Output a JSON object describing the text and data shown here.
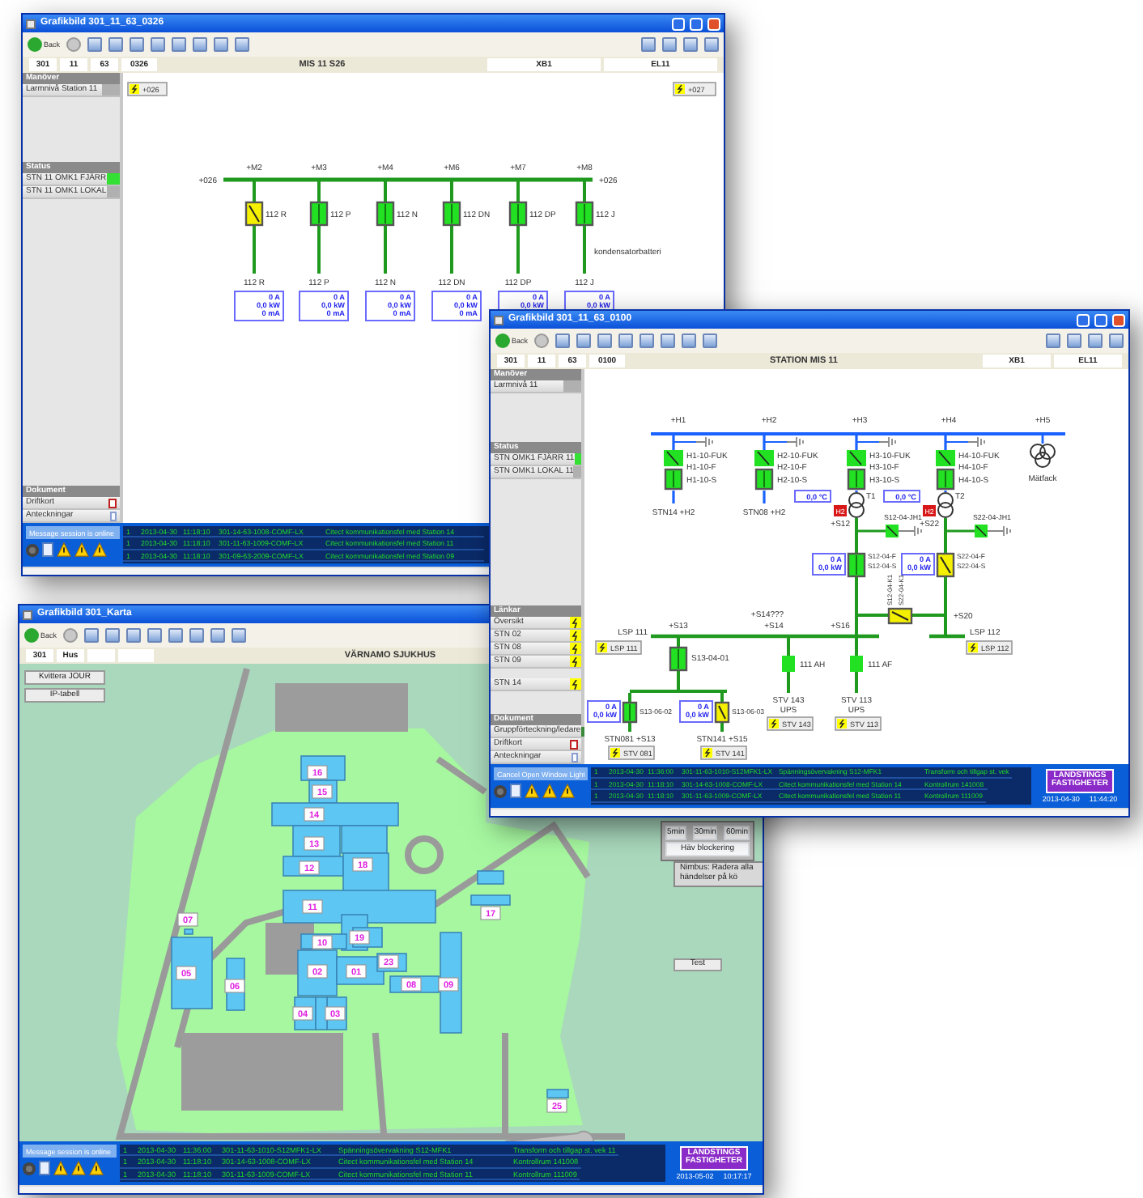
{
  "windows": [
    {
      "title": "Grafikbild 301_11_63_0326",
      "back_label": "Back",
      "address": [
        "301",
        "11",
        "63",
        "0326"
      ],
      "heading": "MIS 11 S26",
      "right_fields": [
        "XB1",
        "EL11"
      ],
      "sidebar": [
        {
          "title": "Manöver",
          "items": [
            {
              "label": "Larmnivå Station 11",
              "kind": "indicator",
              "on": false
            }
          ]
        },
        {
          "title": "Status",
          "items": [
            {
              "label": "STN 11 OMK1 FJÄRR",
              "kind": "indicator",
              "on": true
            },
            {
              "label": "STN 11 OMK1 LOKAL",
              "kind": "indicator",
              "on": false
            }
          ]
        },
        {
          "title": "Dokument",
          "items": [
            {
              "label": "Driftkort",
              "kind": "document"
            },
            {
              "label": "Anteckningar",
              "kind": "note"
            }
          ]
        }
      ],
      "diagram": {
        "kind": "feeders",
        "links": [
          "+026",
          "+027"
        ],
        "bus_ends": [
          "+026",
          "+026"
        ],
        "note": "kondensatorbatteri",
        "feeders": [
          {
            "bus_label": "+M2",
            "breaker": "112 R",
            "open": true,
            "end": "112 R",
            "readings": [
              "0 A",
              "0,0 kW",
              "0 mA"
            ]
          },
          {
            "bus_label": "+M3",
            "breaker": "112 P",
            "open": false,
            "end": "112 P",
            "readings": [
              "0 A",
              "0,0 kW",
              "0 mA"
            ]
          },
          {
            "bus_label": "+M4",
            "breaker": "112 N",
            "open": false,
            "end": "112 N",
            "readings": [
              "0 A",
              "0,0 kW",
              "0 mA"
            ]
          },
          {
            "bus_label": "+M6",
            "breaker": "112 DN",
            "open": false,
            "end": "112 DN",
            "readings": [
              "0 A",
              "0,0 kW",
              "0 mA"
            ]
          },
          {
            "bus_label": "+M7",
            "breaker": "112 DP",
            "open": false,
            "end": "112 DP",
            "readings": [
              "0 A",
              "0,0 kW"
            ]
          },
          {
            "bus_label": "+M8",
            "breaker": "112 J",
            "open": false,
            "end": "112 J",
            "readings": [
              "0 A",
              "0,0 kW"
            ]
          }
        ]
      },
      "alarms": {
        "message": "Message session is online",
        "rows": [
          {
            "n": "1",
            "date": "2013-04-30",
            "time": "11:18:10",
            "tag": "301-14-63-1008-COMF-LX",
            "text": "Citect kommunikationsfel med Station 14"
          },
          {
            "n": "1",
            "date": "2013-04-30",
            "time": "11:18:10",
            "tag": "301-11-63-1009-COMF-LX",
            "text": "Citect kommunikationsfel med Station 11"
          },
          {
            "n": "1",
            "date": "2013-04-30",
            "time": "11:18:10",
            "tag": "301-09-63-2009-COMF-LX",
            "text": "Citect kommunikationsfel med Station 09"
          }
        ]
      }
    },
    {
      "title": "Grafikbild 301_Karta",
      "back_label": "Back",
      "address": [
        "301",
        "Hus"
      ],
      "heading": "VÄRNAMO SJUKHUS",
      "diagram": {
        "kind": "map",
        "buttons": [
          "Kvittera JOUR",
          "IP-tabell"
        ],
        "buildings": [
          "16",
          "15",
          "14",
          "13",
          "12",
          "18",
          "11",
          "10",
          "19",
          "02",
          "01",
          "23",
          "08",
          "09",
          "04",
          "03",
          "05",
          "06",
          "07",
          "17",
          "25"
        ],
        "time_buttons": [
          "5min",
          "30min",
          "60min"
        ],
        "unblock": "Häv blockering",
        "note": "Nimbus: Radera alla händelser på kö",
        "test": "Test"
      },
      "alarms": {
        "message": "Message session is online",
        "rows": [
          {
            "n": "1",
            "date": "2013-04-30",
            "time": "11:36:00",
            "tag": "301-11-63-1010-S12MFK1-LX",
            "text": "Spänningsövervakning S12-MFK1",
            "location": "Transform och tillgap st. vek 11"
          },
          {
            "n": "1",
            "date": "2013-04-30",
            "time": "11:18:10",
            "tag": "301-14-63-1008-COMF-LX",
            "text": "Citect kommunikationsfel med Station 14",
            "location": "Kontrollrum 141008"
          },
          {
            "n": "1",
            "date": "2013-04-30",
            "time": "11:18:10",
            "tag": "301-11-63-1009-COMF-LX",
            "text": "Citect kommunikationsfel med Station 11",
            "location": "Kontrollrum 111009"
          }
        ]
      },
      "logo": [
        "LANDSTINGS",
        "FASTIGHETER"
      ],
      "clock": [
        "2013-05-02",
        "10:17:17"
      ]
    },
    {
      "title": "Grafikbild 301_11_63_0100",
      "back_label": "Back",
      "address": [
        "301",
        "11",
        "63",
        "0100"
      ],
      "heading": "STATION MIS 11",
      "right_fields": [
        "XB1",
        "EL11"
      ],
      "sidebar": [
        {
          "title": "Manöver",
          "items": [
            {
              "label": "Larmnivå 11",
              "kind": "indicator",
              "on": false
            }
          ]
        },
        {
          "title": "Status",
          "items": [
            {
              "label": "STN OMK1 FJÄRR 11",
              "kind": "indicator",
              "on": true
            },
            {
              "label": "STN OMK1 LOKAL 11",
              "kind": "indicator",
              "on": false
            }
          ]
        },
        {
          "title": "Länkar",
          "items": [
            {
              "label": "Översikt",
              "kind": "link"
            },
            {
              "label": "STN 02",
              "kind": "link"
            },
            {
              "label": "STN 08",
              "kind": "link"
            },
            {
              "label": "STN 09",
              "kind": "link"
            },
            {
              "label": "STN 14",
              "kind": "link"
            }
          ]
        },
        {
          "title": "Dokument",
          "items": [
            {
              "label": "Gruppförteckning/ledare",
              "kind": "sheet"
            },
            {
              "label": "Driftkort",
              "kind": "document"
            },
            {
              "label": "Anteckningar",
              "kind": "note"
            }
          ]
        }
      ],
      "diagram": {
        "kind": "station",
        "bus_labels": [
          "+H1",
          "+H2",
          "+H3",
          "+H4",
          "+H5"
        ],
        "incomers": [
          {
            "switch": "H1-10-FUK",
            "f": "H1-10-F",
            "s": "H1-10-S",
            "open": false,
            "end": "STN14 +H2"
          },
          {
            "switch": "H2-10-FUK",
            "f": "H2-10-F",
            "s": "H2-10-S",
            "open": false,
            "end": "STN08 +H2"
          },
          {
            "switch": "H3-10-FUK",
            "f": "H3-10-F",
            "s": "H3-10-S",
            "open": false
          },
          {
            "switch": "H4-10-FUK",
            "f": "H4-10-F",
            "s": "H4-10-S",
            "open": false
          }
        ],
        "meter": "Mätfack",
        "transformers": [
          {
            "name": "T1",
            "temp": "0,0 °C",
            "alarm": "H2",
            "node": "+S12",
            "earth_switch": "S12-04-JH1",
            "f": "S12-04-F",
            "s": "S12-04-S",
            "open": false,
            "readings": [
              "0 A",
              "0,0 kW"
            ]
          },
          {
            "name": "T2",
            "temp": "0,0 °C",
            "alarm": "H2",
            "node": "+S22",
            "earth_switch": "S22-04-JH1",
            "f": "S22-04-F",
            "s": "S22-04-S",
            "open": true,
            "readings": [
              "0 A",
              "0,0 kW"
            ]
          }
        ],
        "coupler": {
          "labels": [
            "S12-04-K1",
            "S22-04-K1"
          ],
          "open": true
        },
        "coupler_node": "+S14???",
        "right_node": "+S20",
        "buses": [
          {
            "name": "LSP 111",
            "link": "LSP 111"
          },
          {
            "name": "LSP 112",
            "link": "LSP 112"
          }
        ],
        "bus_nodes": [
          "+S13",
          "+S14",
          "+S16"
        ],
        "sub_breaker": {
          "label": "S13-04-01",
          "open": false
        },
        "ups": [
          {
            "breaker": "111 AH",
            "name": "STV 143",
            "type": "UPS",
            "link": "STV 143"
          },
          {
            "breaker": "111 AF",
            "name": "STV 113",
            "type": "UPS",
            "link": "STV 113"
          }
        ],
        "outgoing": [
          {
            "breaker": "S13-06-02",
            "open": false,
            "readings": [
              "0 A",
              "0,0 kW"
            ],
            "end": "STN081 +S13",
            "link": "STV 081"
          },
          {
            "breaker": "S13-06-03",
            "open": true,
            "readings": [
              "0 A",
              "0,0 kW"
            ],
            "end": "STN141 +S15",
            "link": "STV 141"
          }
        ]
      },
      "alarms": {
        "message": "Cancel Open Window Light",
        "rows": [
          {
            "n": "1",
            "date": "2013-04-30",
            "time": "11:36:00",
            "tag": "301-11-63-1010-S12MFK1-LX",
            "text": "Spänningsövervakning S12-MFK1",
            "location": "Transform och tillgap st. vek"
          },
          {
            "n": "1",
            "date": "2013-04-30",
            "time": "11:18:10",
            "tag": "301-14-63-1008-COMF-LX",
            "text": "Citect kommunikationsfel med Station 14",
            "location": "Kontrollrum 141008"
          },
          {
            "n": "1",
            "date": "2013-04-30",
            "time": "11:18:10",
            "tag": "301-11-63-1009-COMF-LX",
            "text": "Citect kommunikationsfel med Station 11",
            "location": "Kontrollrum 111009"
          }
        ]
      },
      "logo": [
        "LANDSTINGS",
        "FASTIGHETER"
      ],
      "clock": [
        "2013-04-30",
        "11:44:20"
      ]
    }
  ]
}
